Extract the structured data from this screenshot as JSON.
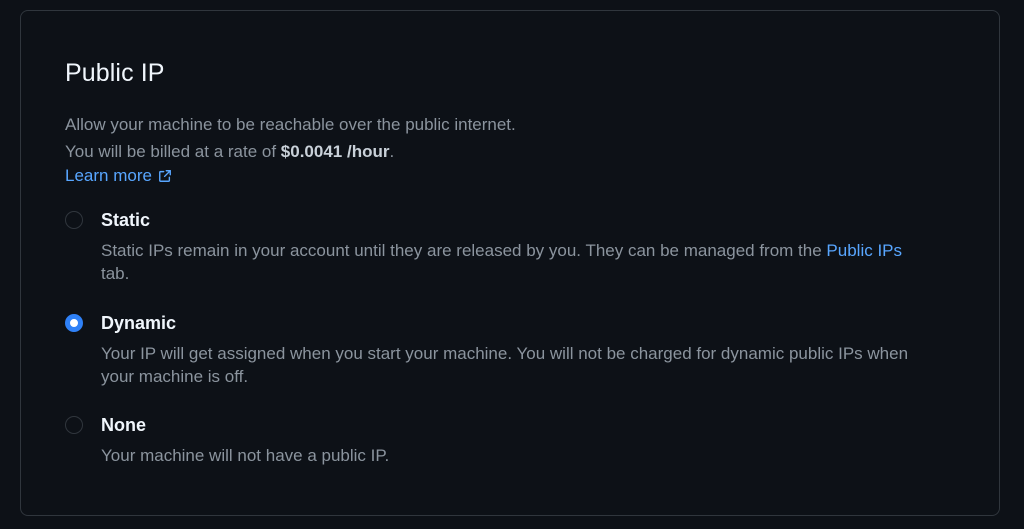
{
  "section": {
    "title": "Public IP",
    "description_line1": "Allow your machine to be reachable over the public internet.",
    "billing_prefix": "You will be billed at a rate of ",
    "billing_price": "$0.0041 /hour",
    "billing_suffix": ".",
    "learn_more": "Learn more",
    "learn_more_icon": "external-link-icon"
  },
  "options": [
    {
      "label": "Static",
      "selected": false,
      "desc_before_link": "Static IPs remain in your account until they are released by you. They can be managed from the ",
      "desc_link": "Public IPs",
      "desc_after_link": " tab."
    },
    {
      "label": "Dynamic",
      "selected": true,
      "desc": "Your IP will get assigned when you start your machine. You will not be charged for dynamic public IPs when your machine is off."
    },
    {
      "label": "None",
      "selected": false,
      "desc": "Your machine will not have a public IP."
    }
  ],
  "colors": {
    "background": "#0d1117",
    "border": "#30363d",
    "accent": "#2f81f7",
    "link": "#58a6ff",
    "text_primary": "#f0f6fc",
    "text_muted": "#8b949e"
  }
}
